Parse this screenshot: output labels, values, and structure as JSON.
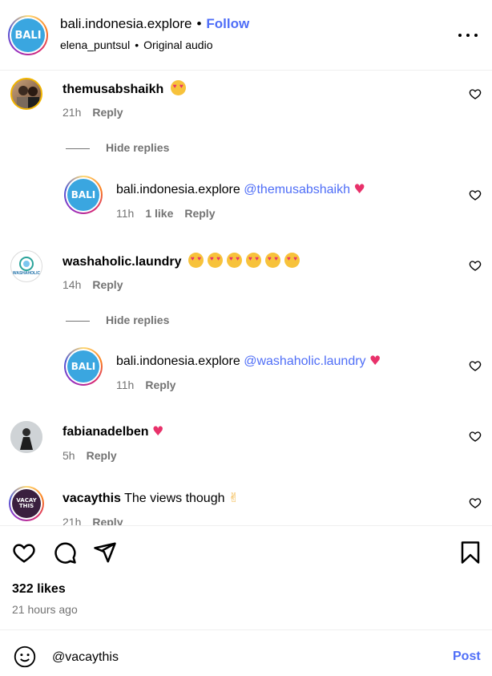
{
  "header": {
    "username": "bali.indonesia.explore",
    "separator": "•",
    "follow_label": "Follow",
    "audio_user": "elena_puntsul",
    "audio_label": "Original audio",
    "avatar_text": "BALI"
  },
  "comments": [
    {
      "username": "themusabshaikh",
      "time": "21h",
      "reply_label": "Reply",
      "hide_replies_label": "Hide replies",
      "reply": {
        "username": "bali.indonesia.explore",
        "mention": "@themusabshaikh",
        "time": "11h",
        "likes": "1 like",
        "reply_label": "Reply",
        "avatar_text": "BALI"
      }
    },
    {
      "username": "washaholic.laundry",
      "time": "14h",
      "reply_label": "Reply",
      "hide_replies_label": "Hide replies",
      "avatar_text": "WASHAHOLIC",
      "reply": {
        "username": "bali.indonesia.explore",
        "mention": "@washaholic.laundry",
        "time": "11h",
        "reply_label": "Reply",
        "avatar_text": "BALI"
      }
    },
    {
      "username": "fabianadelben",
      "time": "5h",
      "reply_label": "Reply"
    },
    {
      "username": "vacaythis",
      "text": "The views though",
      "time": "21h",
      "reply_label": "Reply",
      "avatar_text": "VACAY THIS"
    }
  ],
  "post": {
    "likes": "322 likes",
    "time_ago": "21 hours ago"
  },
  "composer": {
    "value": "@vacaythis",
    "post_label": "Post"
  },
  "colors": {
    "accent": "#4f6ef7",
    "muted": "#737373",
    "heart": "#e8316a",
    "bali_blue": "#3aa6e0"
  }
}
